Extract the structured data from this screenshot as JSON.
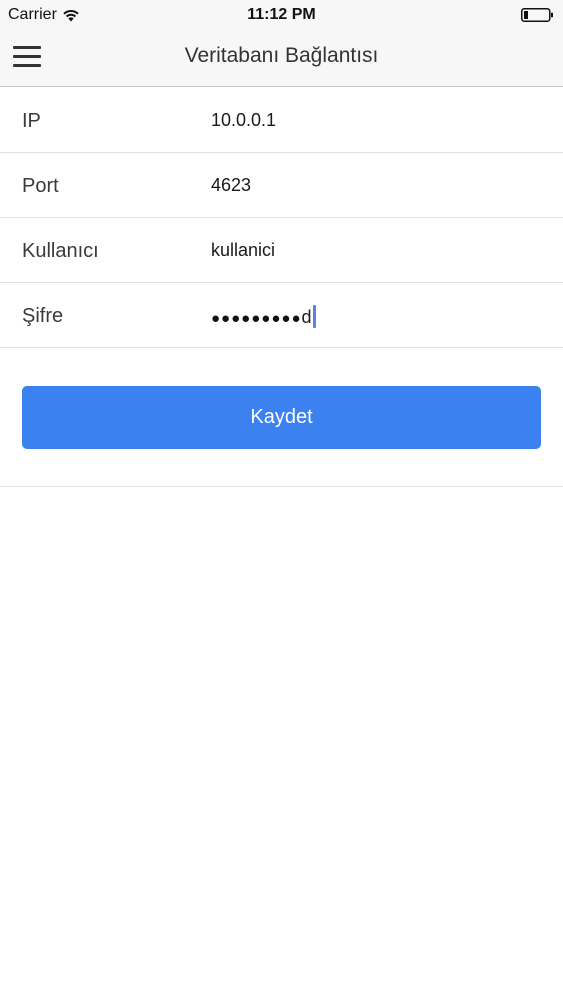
{
  "status_bar": {
    "carrier": "Carrier",
    "time": "11:12 PM",
    "icons": [
      "wifi-icon",
      "battery-icon"
    ]
  },
  "nav": {
    "title": "Veritabanı Bağlantısı",
    "menu_icon": "hamburger-menu-icon"
  },
  "form": {
    "rows": [
      {
        "label": "IP",
        "value": "10.0.0.1"
      },
      {
        "label": "Port",
        "value": "4623"
      },
      {
        "label": "Kullanıcı",
        "value": "kullanici"
      },
      {
        "label": "Şifre",
        "masked_dots": "●●●●●●●●●",
        "last_char": "d"
      }
    ]
  },
  "actions": {
    "save_label": "Kaydet"
  },
  "colors": {
    "accent": "#3b82f0",
    "bar_background": "#f7f7f8",
    "separator": "#e0e0e0"
  }
}
